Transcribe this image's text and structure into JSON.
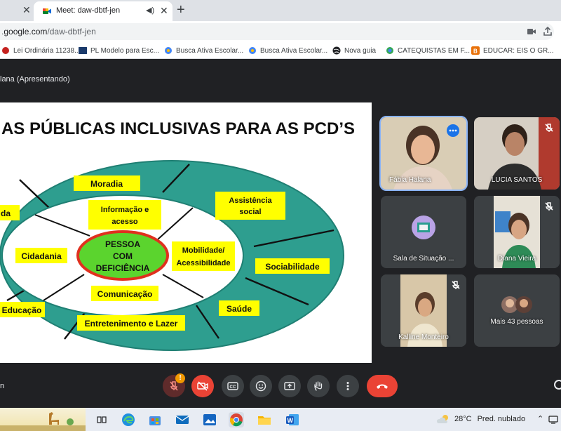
{
  "browser": {
    "tab_title": "Meet: daw-dbtf-jen",
    "url_host": "google.com",
    "url_path": "/daw-dbtf-jen",
    "url_prefix_clipped": "."
  },
  "bookmarks": [
    {
      "label": "Lei Ordinária 11238...",
      "icon_color": "#c5221f"
    },
    {
      "label": "PL Modelo para Esc...",
      "icon_color": "#1a3a6b"
    },
    {
      "label": "Busca Ativa Escolar...",
      "icon_color": "#4285f4"
    },
    {
      "label": "Busca Ativa Escolar...",
      "icon_color": "#4285f4"
    },
    {
      "label": "Nova guia",
      "icon_color": "#202124"
    },
    {
      "label": "CATEQUISTAS EM F...",
      "icon_color": "#34a853"
    },
    {
      "label": "EDUCAR: EIS O GR...",
      "icon_color": "#e8710a"
    }
  ],
  "meet": {
    "presenting_label": "lana (Apresentando)",
    "controls_left_label": "n",
    "notification_badge": "!"
  },
  "slide": {
    "title": "AS PÚBLICAS INCLUSIVAS PARA AS PCD’S",
    "center": [
      "PESSOA",
      "COM",
      "DEFICIÊNCIA"
    ],
    "inner": {
      "info": [
        "Informação e",
        "acesso"
      ],
      "cidadania": "Cidadania",
      "mobilidade": [
        "Mobilidade/",
        "Acessibilidade"
      ],
      "comunicacao": "Comunicação"
    },
    "outer": {
      "moradia": "Moradia",
      "assistencia": [
        "Assistência",
        "social"
      ],
      "sociabilidade": "Sociabilidade",
      "saude": "Saúde",
      "entretenimento": "Entretenimento e Lazer",
      "educacao": "Educação",
      "left_clipped": "da"
    },
    "colors": {
      "ring": "#2e9e8f",
      "label_bg": "#ffff00",
      "center_bg": "#5bd42e",
      "center_border": "#e0301e"
    }
  },
  "participants": [
    {
      "name": "Fábia Halana",
      "speaking": true
    },
    {
      "name": "LUCIA SANTOS",
      "muted": true
    },
    {
      "name": "Sala de Situação ...",
      "muted": false
    },
    {
      "name": "Diana Vieira",
      "muted": true
    },
    {
      "name": "Kalline Monteiro",
      "muted": true
    },
    {
      "name": "Mais 43 pessoas"
    }
  ],
  "taskbar": {
    "temperature": "28°C",
    "condition": "Pred. nublado"
  }
}
